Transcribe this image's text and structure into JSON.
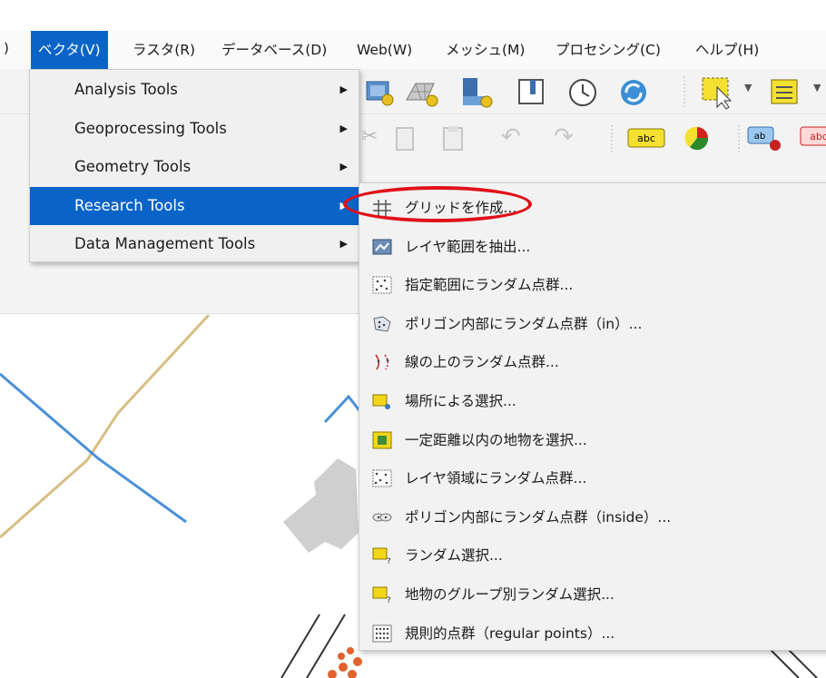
{
  "menubar": {
    "stub": ")",
    "items": [
      {
        "label": "ベクタ(V)",
        "active": true
      },
      {
        "label": "ラスタ(R)"
      },
      {
        "label": "データベース(D)"
      },
      {
        "label": "Web(W)"
      },
      {
        "label": "メッシュ(M)"
      },
      {
        "label": "プロセシング(C)"
      },
      {
        "label": "ヘルプ(H)"
      }
    ]
  },
  "vector_menu": {
    "items": [
      {
        "label": "Analysis Tools",
        "has_submenu": true
      },
      {
        "label": "Geoprocessing Tools",
        "has_submenu": true
      },
      {
        "label": "Geometry Tools",
        "has_submenu": true
      },
      {
        "label": "Research Tools",
        "has_submenu": true,
        "highlighted": true
      },
      {
        "label": "Data Management Tools",
        "has_submenu": true
      }
    ]
  },
  "research_submenu": {
    "items": [
      {
        "label": "グリッドを作成...",
        "icon": "grid-icon",
        "circled": true
      },
      {
        "label": "レイヤ範囲を抽出...",
        "icon": "layer-extent-icon"
      },
      {
        "label": "指定範囲にランダム点群...",
        "icon": "random-points-extent-icon"
      },
      {
        "label": "ポリゴン内部にランダム点群（in）...",
        "icon": "random-points-polygon-icon"
      },
      {
        "label": "線の上のランダム点群...",
        "icon": "random-points-line-icon"
      },
      {
        "label": "場所による選択...",
        "icon": "select-location-icon"
      },
      {
        "label": "一定距離以内の地物を選択...",
        "icon": "select-distance-icon"
      },
      {
        "label": "レイヤ領域にランダム点群...",
        "icon": "random-points-layer-icon"
      },
      {
        "label": "ポリゴン内部にランダム点群（inside）...",
        "icon": "random-points-inside-icon"
      },
      {
        "label": "ランダム選択...",
        "icon": "random-select-icon"
      },
      {
        "label": "地物のグループ別ランダム選択...",
        "icon": "random-select-subset-icon"
      },
      {
        "label": "規則的点群（regular points）...",
        "icon": "regular-points-icon"
      }
    ]
  },
  "toolbar": {
    "label_chips": [
      "abc",
      "ab",
      "abc"
    ]
  },
  "colors": {
    "menu_highlight": "#0a64c8",
    "callout_ring": "#e0101a",
    "map_line_tan": "#d8be82",
    "map_line_blue": "#4a90d9",
    "point_orange": "#e2622d"
  }
}
